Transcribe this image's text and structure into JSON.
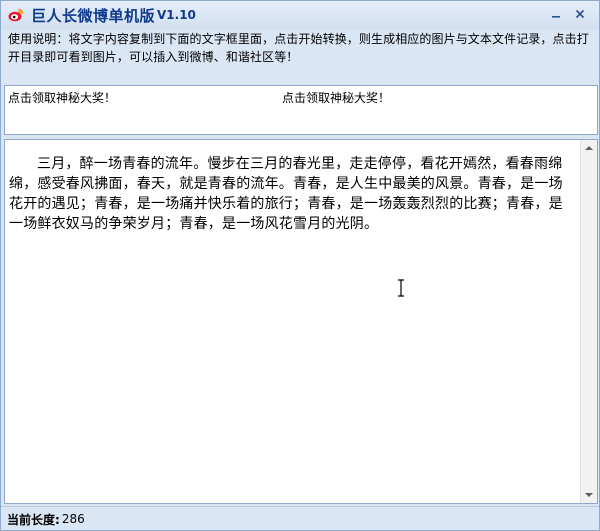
{
  "window": {
    "title": "巨人长微博单机版",
    "version": "V1.10",
    "minimize_icon": "minimize-icon",
    "close_icon": "close-icon"
  },
  "instructions": {
    "text": "使用说明：将文字内容复制到下面的文字框里面，点击开始转换，则生成相应的图片与文本文件记录，点击打开目录即可看到图片，可以插入到微博、和谐社区等！"
  },
  "promo": {
    "left_label": "点击领取神秘大奖！",
    "right_label": "点击领取神秘大奖！"
  },
  "editor": {
    "content": "三月，醉一场青春的流年。慢步在三月的春光里，走走停停，看花开嫣然，看春雨绵绵，感受春风拂面，春天，就是青春的流年。青春，是人生中最美的风景。青春，是一场花开的遇见；青春，是一场痛并快乐着的旅行；青春，是一场轰轰烈烈的比赛；青春，是一场鲜衣奴马的争荣岁月；青春，是一场风花雪月的光阴。"
  },
  "status": {
    "label": "当前长度:",
    "value": "286"
  },
  "colors": {
    "window_bg": "#dbe6f5",
    "title_text": "#0f3a8c",
    "border": "#8ea8cc"
  }
}
